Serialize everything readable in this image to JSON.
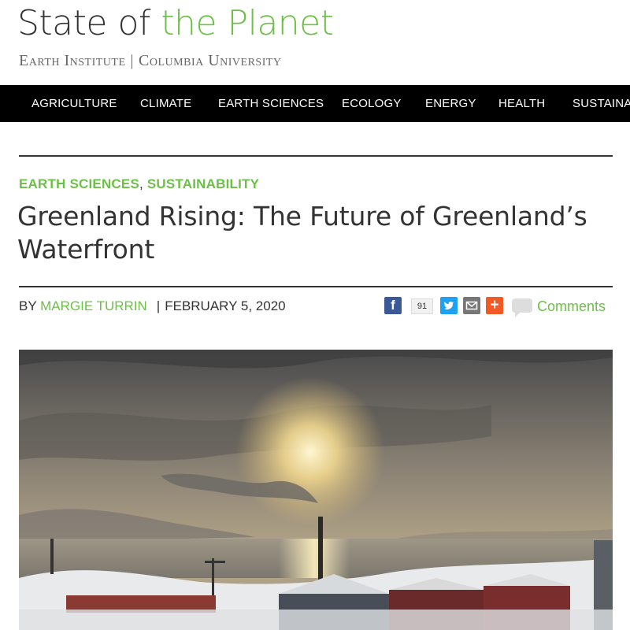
{
  "site": {
    "title_part1": "State of ",
    "title_part2": "the Planet",
    "subtitle_left": "Earth Institute",
    "subtitle_sep": "|",
    "subtitle_right": "Columbia University"
  },
  "nav": {
    "items": [
      "AGRICULTURE",
      "CLIMATE",
      "EARTH SCIENCES",
      "ECOLOGY",
      "ENERGY",
      "HEALTH",
      "SUSTAINA"
    ]
  },
  "article": {
    "categories": [
      "EARTH SCIENCES",
      "SUSTAINABILITY"
    ],
    "category_separator": ",",
    "title": "Greenland Rising: The Future of Greenland’s Waterfront",
    "byline_prefix": "BY ",
    "author": "MARGIE TURRIN",
    "byline_sep": "|",
    "date": "FEBRUARY 5, 2020"
  },
  "share": {
    "facebook_icon": "f",
    "share_count": "91",
    "plus_icon": "+",
    "comments_label": "Comments"
  },
  "colors": {
    "accent_green": "#6cbf47",
    "nav_background": "#000000",
    "facebook": "#3b5998",
    "twitter": "#1da1f2",
    "email": "#777777",
    "addthis": "#f15a24"
  }
}
